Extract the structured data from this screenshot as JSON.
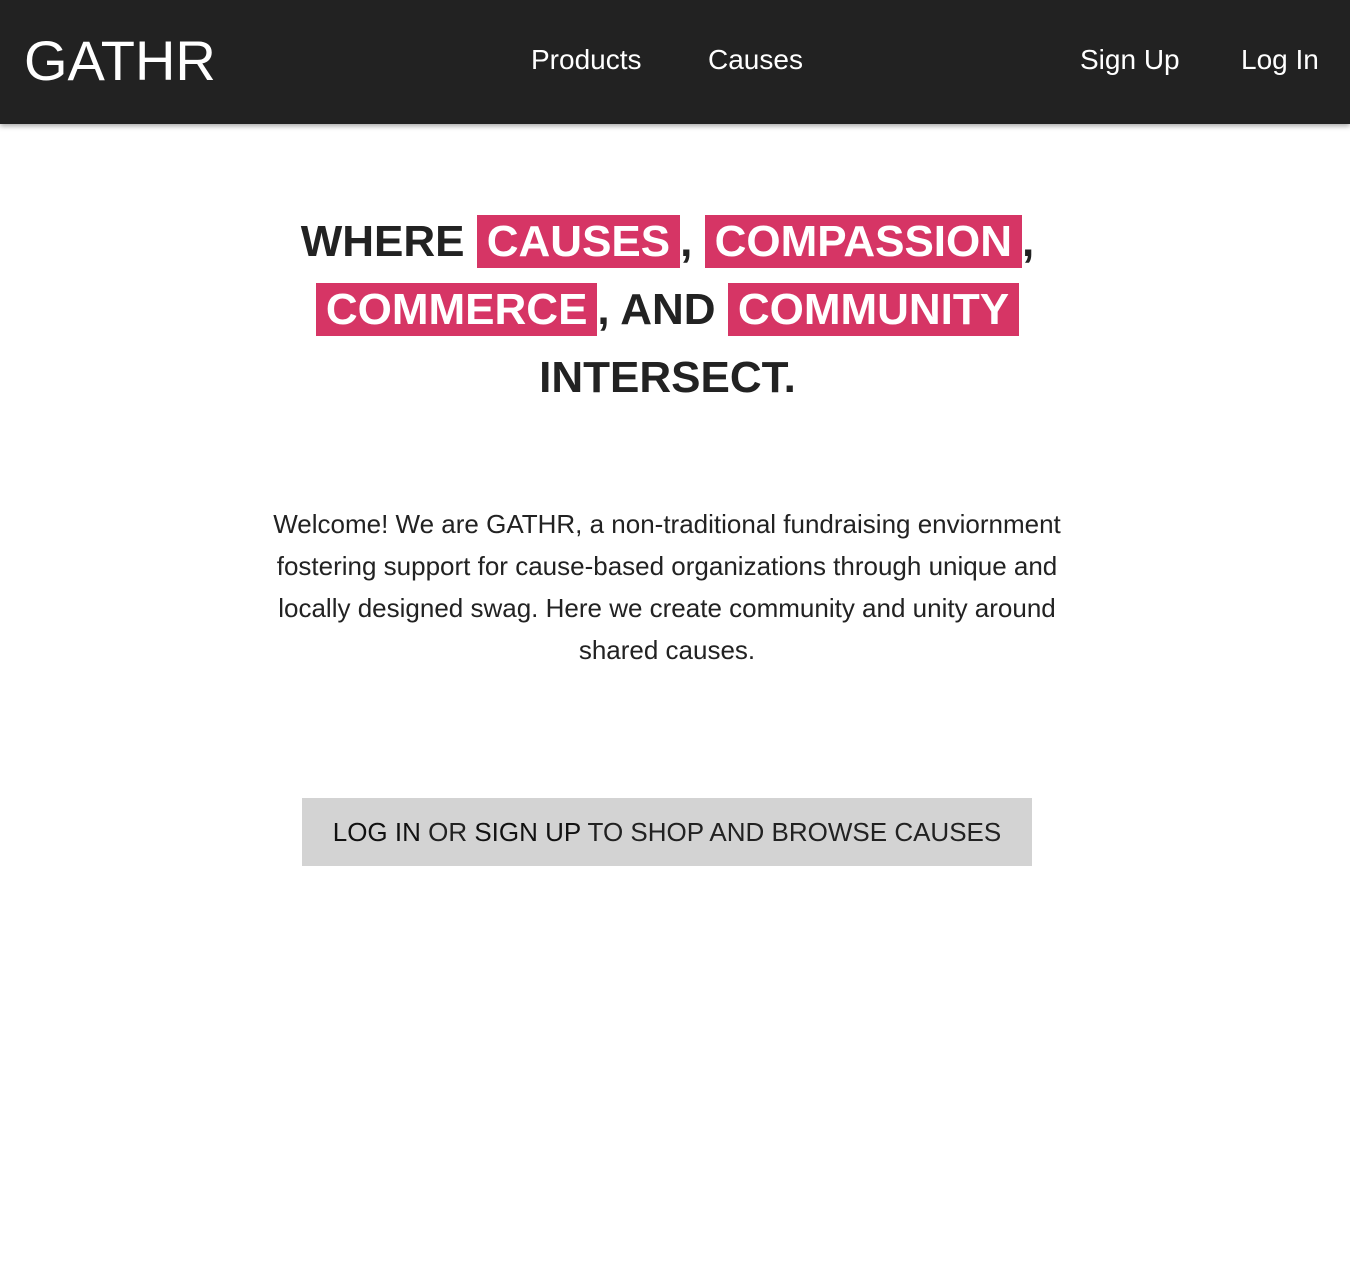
{
  "navbar": {
    "brand": "GATHR",
    "links": {
      "products": "Products",
      "causes": "Causes",
      "signup": "Sign Up",
      "login": "Log In"
    }
  },
  "hero": {
    "where": "WHERE",
    "causes": "CAUSES",
    "comma1": ",",
    "compassion": "COMPASSION",
    "comma2": ",",
    "commerce": "COMMERCE",
    "and": ", AND",
    "community": "COMMUNITY",
    "intersect": "INTERSECT.",
    "highlight_color": "#d63565"
  },
  "intro": {
    "text": "Welcome! We are GATHR, a non-traditional fundraising enviornment fostering support for cause-based organizations through unique and locally designed swag. Here we create community and unity around shared causes."
  },
  "cta": {
    "login": "LOG IN",
    "or": "OR",
    "signup": "SIGN UP",
    "rest": "TO SHOP AND BROWSE CAUSES"
  }
}
